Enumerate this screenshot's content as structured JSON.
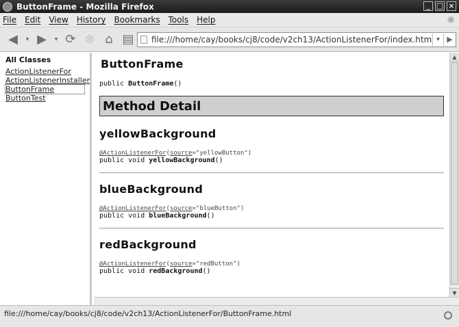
{
  "window": {
    "title": "ButtonFrame - Mozilla Firefox"
  },
  "menu": [
    "File",
    "Edit",
    "View",
    "History",
    "Bookmarks",
    "Tools",
    "Help"
  ],
  "nav": {
    "url": "file:///home/cay/books/cj8/code/v2ch13/ActionListenerFor/index.html"
  },
  "left": {
    "heading": "All Classes",
    "classes": [
      "ActionListenerFor",
      "ActionListenerInstaller",
      "ButtonFrame",
      "ButtonTest"
    ]
  },
  "right": {
    "class_title": "ButtonFrame",
    "ctor_prefix": "public ",
    "ctor_name": "ButtonFrame",
    "ctor_suffix": "()",
    "method_detail": "Method Detail",
    "methods": [
      {
        "name": "yellowBackground",
        "anno_name": "@ActionListenerFor",
        "anno_key": "source",
        "anno_val": "=\"yellowButton\")",
        "sig_prefix": "public void ",
        "sig_name": "yellowBackground",
        "sig_suffix": "()"
      },
      {
        "name": "blueBackground",
        "anno_name": "@ActionListenerFor",
        "anno_key": "source",
        "anno_val": "=\"blueButton\")",
        "sig_prefix": "public void ",
        "sig_name": "blueBackground",
        "sig_suffix": "()"
      },
      {
        "name": "redBackground",
        "anno_name": "@ActionListenerFor",
        "anno_key": "source",
        "anno_val": "=\"redButton\")",
        "sig_prefix": "public void ",
        "sig_name": "redBackground",
        "sig_suffix": "()"
      }
    ]
  },
  "status": {
    "text": "file:///home/cay/books/cj8/code/v2ch13/ActionListenerFor/ButtonFrame.html"
  }
}
